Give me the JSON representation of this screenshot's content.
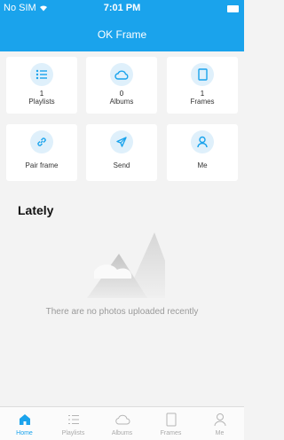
{
  "status_bar": {
    "carrier": "No SIM",
    "time": "7:01 PM"
  },
  "nav": {
    "title": "OK Frame"
  },
  "tiles": [
    {
      "count": "1",
      "label": "Playlists",
      "icon": "list-icon"
    },
    {
      "count": "0",
      "label": "Albums",
      "icon": "cloud-icon"
    },
    {
      "count": "1",
      "label": "Frames",
      "icon": "frame-icon"
    },
    {
      "label": "Pair frame",
      "icon": "link-icon"
    },
    {
      "label": "Send",
      "icon": "send-icon"
    },
    {
      "label": "Me",
      "icon": "person-icon"
    }
  ],
  "lately": {
    "title": "Lately",
    "empty_text": "There are no photos uploaded recently"
  },
  "tabs": [
    {
      "label": "Home",
      "icon": "home-icon",
      "active": true
    },
    {
      "label": "Playlists",
      "icon": "list-icon"
    },
    {
      "label": "Albums",
      "icon": "cloud-icon"
    },
    {
      "label": "Frames",
      "icon": "frame-icon"
    },
    {
      "label": "Me",
      "icon": "person-icon"
    }
  ],
  "colors": {
    "accent": "#1aa3ec",
    "icon_bg": "#dff0fb",
    "background": "#f3f3f3"
  }
}
